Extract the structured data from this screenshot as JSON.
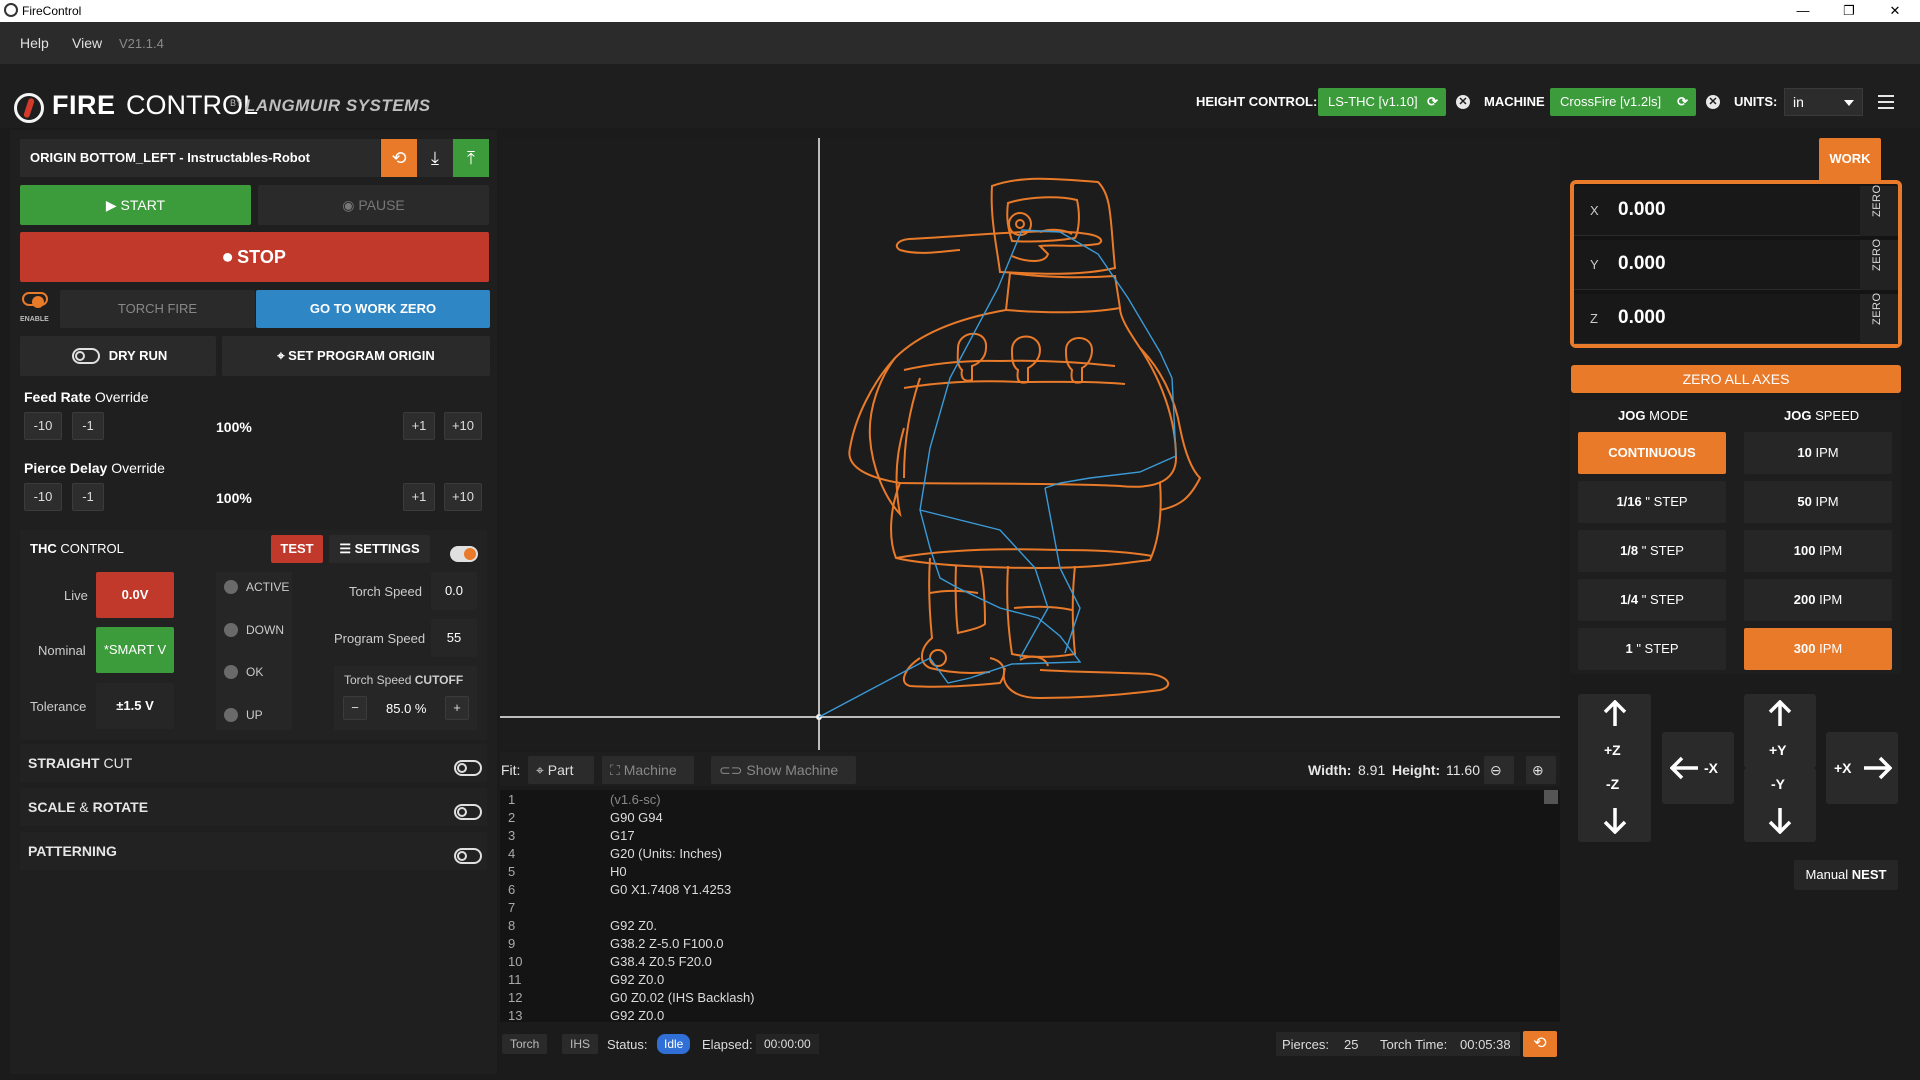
{
  "window": {
    "title": "FireControl",
    "minimize": "—",
    "restore": "❐",
    "close": "✕"
  },
  "menu": {
    "help": "Help",
    "view": "View",
    "version": "V21.1.4"
  },
  "brand": {
    "fire": "FIRE",
    "control": "CONTROL",
    "by": "BY",
    "company": "LANGMUIR SYSTEMS"
  },
  "header": {
    "height_control_label": "HEIGHT CONTROL:",
    "height_control_value": "LS-THC  [v1.10]",
    "machine_label": "MACHINE",
    "machine_value": "CrossFire  [v1.2ls]",
    "units_label": "UNITS:",
    "units_value": "in",
    "close_glyph": "✕",
    "refresh_glyph": "⟳"
  },
  "file": {
    "name": "ORIGIN BOTTOM_LEFT - Instructables-Robot",
    "undo_glyph": "⟲",
    "download_glyph": "⤓",
    "upload_glyph": "⤒"
  },
  "controls": {
    "start": "START",
    "pause": "PAUSE",
    "stop": "STOP",
    "enable": "ENABLE",
    "torch_fire": "TORCH FIRE",
    "go_to_work_zero": "GO TO WORK ZERO",
    "dry_run": "DRY RUN",
    "set_program_origin": "SET PROGRAM ORIGIN"
  },
  "feed_rate": {
    "label": "Feed Rate",
    "sub": "Override",
    "minus10": "-10",
    "minus1": "-1",
    "value": "100%",
    "plus1": "+1",
    "plus10": "+10"
  },
  "pierce_delay": {
    "label": "Pierce Delay",
    "sub": "Override",
    "minus10": "-10",
    "minus1": "-1",
    "value": "100%",
    "plus1": "+1",
    "plus10": "+10"
  },
  "thc": {
    "title_bold": "THC",
    "title": "CONTROL",
    "test": "TEST",
    "settings": "SETTINGS",
    "live_label": "Live",
    "live_value": "0.0V",
    "nominal_label": "Nominal",
    "nominal_value": "*SMART V",
    "tolerance_label": "Tolerance",
    "tolerance_value": "±1.5  V",
    "status": [
      "ACTIVE",
      "DOWN",
      "OK",
      "UP"
    ],
    "torch_speed_label": "Torch Speed",
    "torch_speed_value": "0.0",
    "program_speed_label": "Program Speed",
    "program_speed_value": "55",
    "cutoff_label": "Torch Speed",
    "cutoff_bold": "CUTOFF",
    "cutoff_value": "85.0 %",
    "cutoff_minus": "−",
    "cutoff_plus": "+"
  },
  "sections": {
    "straight_bold": "STRAIGHT",
    "straight": "CUT",
    "scale_bold": "SCALE",
    "scale_amp": "&",
    "scale": "ROTATE",
    "patterning": "PATTERNING"
  },
  "fitbar": {
    "fit_label": "Fit:",
    "part": "Part",
    "machine": "Machine",
    "show_machine": "Show Machine",
    "width_label": "Width:",
    "width_value": "8.91",
    "height_label": "Height:",
    "height_value": "11.60"
  },
  "gcode": [
    {
      "n": "1",
      "t": "(v1.6-sc)"
    },
    {
      "n": "2",
      "t": "G90 G94"
    },
    {
      "n": "3",
      "t": "G17"
    },
    {
      "n": "4",
      "t": "G20 (Units: Inches)"
    },
    {
      "n": "5",
      "t": "H0"
    },
    {
      "n": "6",
      "t": "G0 X1.7408 Y1.4253"
    },
    {
      "n": "7",
      "t": ""
    },
    {
      "n": "8",
      "t": "G92 Z0."
    },
    {
      "n": "9",
      "t": "G38.2 Z-5.0 F100.0"
    },
    {
      "n": "10",
      "t": "G38.4 Z0.5 F20.0"
    },
    {
      "n": "11",
      "t": "G92 Z0.0"
    },
    {
      "n": "12",
      "t": "G0 Z0.02 (IHS Backlash)"
    },
    {
      "n": "13",
      "t": "G92 Z0.0"
    }
  ],
  "statusbar": {
    "torch": "Torch",
    "ihs": "IHS",
    "status_label": "Status:",
    "status_value": "Idle",
    "elapsed_label": "Elapsed:",
    "elapsed_value": "00:00:00",
    "pierces_label": "Pierces:",
    "pierces_value": "25",
    "torch_time_label": "Torch Time:",
    "torch_time_value": "00:05:38"
  },
  "dro": {
    "tab": "WORK",
    "axes": [
      {
        "axis": "X",
        "value": "0.000",
        "zero": "ZERO"
      },
      {
        "axis": "Y",
        "value": "0.000",
        "zero": "ZERO"
      },
      {
        "axis": "Z",
        "value": "0.000",
        "zero": "ZERO"
      }
    ],
    "zero_all": "ZERO ALL AXES"
  },
  "jog": {
    "mode_bold": "JOG",
    "mode": "MODE",
    "speed_bold": "JOG",
    "speed": "SPEED",
    "modes": [
      {
        "bold": "CONTINUOUS",
        "rest": "",
        "active": true
      },
      {
        "bold": "1/16",
        "rest": " \" STEP",
        "active": false
      },
      {
        "bold": "1/8",
        "rest": " \" STEP",
        "active": false
      },
      {
        "bold": "1/4",
        "rest": " \" STEP",
        "active": false
      },
      {
        "bold": "1",
        "rest": " \" STEP",
        "active": false
      }
    ],
    "speeds": [
      {
        "bold": "10",
        "rest": " IPM",
        "active": false
      },
      {
        "bold": "50",
        "rest": " IPM",
        "active": false
      },
      {
        "bold": "100",
        "rest": " IPM",
        "active": false
      },
      {
        "bold": "200",
        "rest": " IPM",
        "active": false
      },
      {
        "bold": "300",
        "rest": " IPM",
        "active": true
      }
    ],
    "plus_z": "+Z",
    "minus_z": "-Z",
    "minus_x": "-X",
    "plus_x": "+X",
    "plus_y": "+Y",
    "minus_y": "-Y",
    "manual": "Manual",
    "nest": "NEST"
  },
  "colors": {
    "accent": "#e87a2a",
    "green": "#3c9b3a",
    "blue": "#2f86c5",
    "red": "#c0392b",
    "toolpath": "#e87a2a",
    "rapid": "#3a9bd8"
  }
}
